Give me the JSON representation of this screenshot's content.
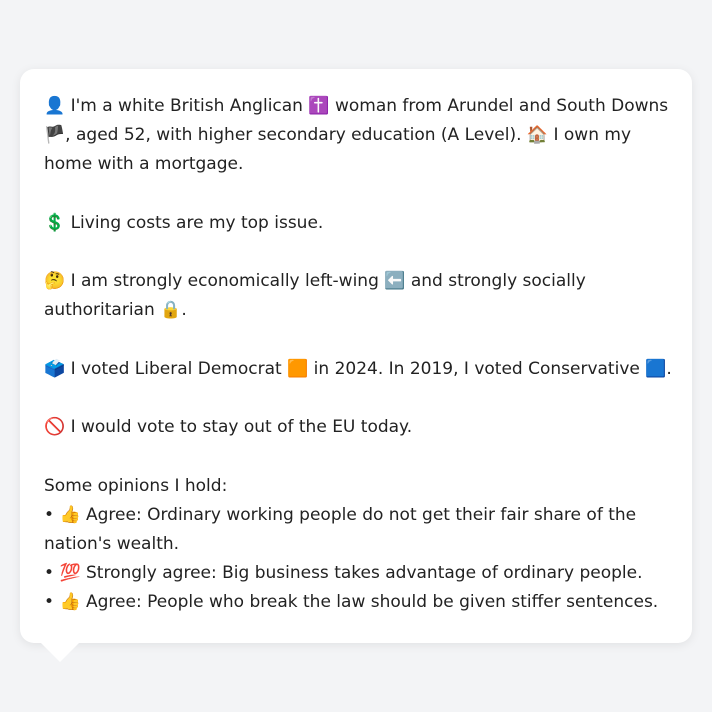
{
  "profile": {
    "intro_icon": "👤",
    "intro_a": "I'm a white British Anglican",
    "religion_icon": "✝️",
    "intro_b": "woman from Arundel and South Downs",
    "flag_icon": "🏴",
    "intro_c": ", aged 52, with higher secondary education (A Level).",
    "home_icon": "🏠",
    "intro_d": "I own my home with a mortgage."
  },
  "issue": {
    "icon": "💲",
    "text": "Living costs are my top issue."
  },
  "ideology": {
    "icon": "🤔",
    "text_a": "I am strongly economically left-wing",
    "left_icon": "⬅️",
    "text_b": "and strongly socially authoritarian",
    "lock_icon": "🔒",
    "text_c": "."
  },
  "vote": {
    "icon": "🗳️",
    "text_a": "I voted Liberal Democrat",
    "libdem_icon": "🟧",
    "text_b": "in 2024. In 2019, I voted Conservative",
    "con_icon": "🟦",
    "text_c": "."
  },
  "eu": {
    "icon": "🚫",
    "text": "I would vote to stay out of the EU today."
  },
  "opinions": {
    "heading": "Some opinions I hold:",
    "items": [
      {
        "bullet": "•",
        "icon": "👍",
        "text": "Agree: Ordinary working people do not get their fair share of the nation's wealth."
      },
      {
        "bullet": "•",
        "icon": "💯",
        "text": "Strongly agree: Big business takes advantage of ordinary people."
      },
      {
        "bullet": "•",
        "icon": "👍",
        "text": "Agree: People who break the law should be given stiffer sentences."
      }
    ]
  },
  "colors": {
    "background": "#f3f4f6",
    "card": "#ffffff",
    "text": "#222222"
  }
}
